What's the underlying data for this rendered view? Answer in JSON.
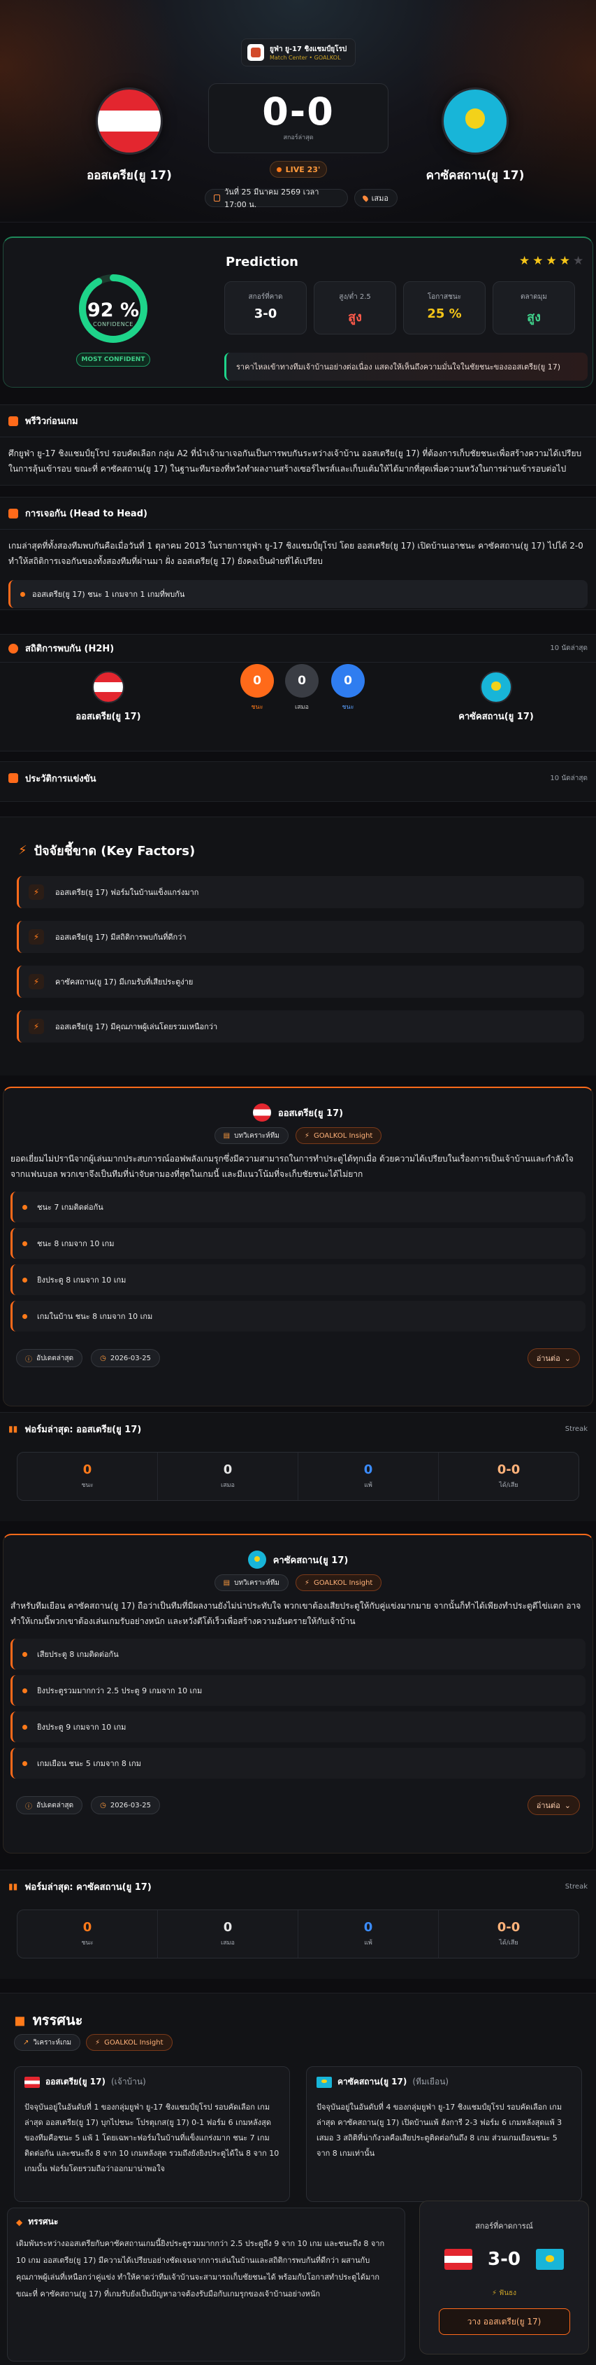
{
  "match": {
    "league_name": "ยูฟ่า ยู-17 ชิงแชมป์ยุโรป",
    "league_sub": "Match Center • GOALKOL",
    "home": "ออสเตรีย(ยู 17)",
    "away": "คาซัคสถาน(ยู 17)",
    "score": "0-0",
    "score_label": "สกอร์ล่าสุด",
    "status": "LIVE 23'",
    "date": "วันที่ 25 มีนาคม 2569 เวลา 17:00 น.",
    "venue": "เสมอ"
  },
  "prediction": {
    "title": "Prediction",
    "confidence": "92 %",
    "confidence_label": "CONFIDENCE",
    "confidence_value": 0.92,
    "confidence_badge": "MOST CONFIDENT",
    "stars": 4,
    "cards": [
      {
        "title": "สกอร์ที่คาด",
        "value": "3-0",
        "color": "#ffffff"
      },
      {
        "title": "สูง/ต่ำ 2.5",
        "value": "สูง",
        "color": "#ff5a4a"
      },
      {
        "title": "โอกาสชนะ",
        "value": "25 %",
        "color": "#f5c518"
      },
      {
        "title": "ตลาดมุม",
        "value": "สูง",
        "color": "#3fd08a"
      }
    ],
    "advice": "ราคาไหลเข้าทางทีมเจ้าบ้านอย่างต่อเนื่อง แสดงให้เห็นถึงความมั่นใจในชัยชนะของออสเตรีย(ยู 17)"
  },
  "preview": {
    "title": "พรีวิวก่อนเกม",
    "text": "ศึกยูฟ่า ยู-17 ชิงแชมป์ยุโรป รอบคัดเลือก กลุ่ม A2 ที่นำเจ้ามาเจอกันเป็นการพบกันระหว่างเจ้าบ้าน ออสเตรีย(ยู 17) ที่ต้องการเก็บชัยชนะเพื่อสร้างความได้เปรียบในการลุ้นเข้ารอบ ขณะที่ คาซัคสถาน(ยู 17) ในฐานะทีมรองที่หวังทำผลงานสร้างเซอร์ไพรส์และเก็บแต้มให้ได้มากที่สุดเพื่อความหวังในการผ่านเข้ารอบต่อไป"
  },
  "h2h_text": {
    "title": "การเจอกัน (Head to Head)",
    "text": "เกมล่าสุดที่ทั้งสองทีมพบกันคือเมื่อวันที่ 1 ตุลาคม 2013 ในรายการยูฟ่า ยู-17 ชิงแชมป์ยุโรป โดย ออสเตรีย(ยู 17) เปิดบ้านเอาชนะ คาซัคสถาน(ยู 17) ไปได้ 2-0 ทำให้สถิติการเจอกันของทั้งสองทีมที่ผ่านมา ฝั่ง ออสเตรีย(ยู 17) ยังคงเป็นฝ่ายที่ได้เปรียบ",
    "highlight": "ออสเตรีย(ยู 17) ชนะ 1 เกมจาก 1 เกมที่พบกัน"
  },
  "h2h_stats": {
    "title": "สถิติการพบกัน (H2H)",
    "right": "10 นัดล่าสุด",
    "home": "ออสเตรีย(ยู 17)",
    "away": "คาซัคสถาน(ยู 17)",
    "wins": "0",
    "wins_label": "ชนะ",
    "draws": "0",
    "draws_label": "เสมอ",
    "losses": "0",
    "losses_label": "ชนะ"
  },
  "history": {
    "title": "ประวัติการแข่งขัน",
    "right": "10 นัดล่าสุด"
  },
  "factors": {
    "title": "ปัจจัยชี้ขาด (Key Factors)",
    "items": [
      "ออสเตรีย(ยู 17) ฟอร์มในบ้านแข็งแกร่งมาก",
      "ออสเตรีย(ยู 17) มีสถิติการพบกันที่ดีกว่า",
      "คาซัคสถาน(ยู 17) มีเกมรับที่เสียประตูง่าย",
      "ออสเตรีย(ยู 17) มีคุณภาพผู้เล่นโดยรวมเหนือกว่า"
    ]
  },
  "home_card": {
    "team": "ออสเตรีย(ยู 17)",
    "badge1": "บทวิเคราะห์ทีม",
    "badge2": "GOALKOL Insight",
    "text": "ยอดเยี่ยมไม่ปรานีจากผู้เล่นมากประสบการณ์ออฟพลังเกมรุกซึ่งมีความสามารถในการทำประตูได้ทุกเมื่อ ด้วยความได้เปรียบในเรื่องการเป็นเจ้าบ้านและกำลังใจจากแฟนบอล พวกเขาจึงเป็นทีมที่น่าจับตามองที่สุดในเกมนี้ และมีแนวโน้มที่จะเก็บชัยชนะได้ไม่ยาก",
    "lines": [
      "ชนะ 7 เกมติดต่อกัน",
      "ชนะ 8 เกมจาก 10 เกม",
      "ยิงประตู 8 เกมจาก 10 เกม",
      "เกมในบ้าน ชนะ 8 เกมจาก 10 เกม"
    ],
    "foot1": "อัปเดตล่าสุด",
    "foot2": "2026-03-25",
    "readmore": "อ่านต่อ"
  },
  "home_form": {
    "title": "ฟอร์มล่าสุด: ออสเตรีย(ยู 17)",
    "right": "Streak",
    "cells": [
      {
        "n": "0",
        "l": "ชนะ",
        "c": "#ff7a1a"
      },
      {
        "n": "0",
        "l": "เสมอ",
        "c": "#e6e6e6"
      },
      {
        "n": "0",
        "l": "แพ้",
        "c": "#3b8cff"
      },
      {
        "n": "0-0",
        "l": "ได้/เสีย",
        "c": "#ffb27a"
      }
    ]
  },
  "away_card": {
    "team": "คาซัคสถาน(ยู 17)",
    "badge1": "บทวิเคราะห์ทีม",
    "badge2": "GOALKOL Insight",
    "text": "สำหรับทีมเยือน คาซัคสถาน(ยู 17) ถือว่าเป็นทีมที่มีผลงานยังไม่น่าประทับใจ พวกเขาต้องเสียประตูให้กับคู่แข่งมากมาย จากนั้นก็ทำได้เพียงทำประตูตีไข่แตก อาจทำให้เกมนี้พวกเขาต้องเล่นเกมรับอย่างหนัก และหวังตีโต้เร็วเพื่อสร้างความอันตรายให้กับเจ้าบ้าน",
    "lines": [
      "เสียประตู 8 เกมติดต่อกัน",
      "ยิงประตูรวมมากกว่า 2.5 ประตู 9 เกมจาก 10 เกม",
      "ยิงประตู 9 เกมจาก 10 เกม",
      "เกมเยือน ชนะ 5 เกมจาก 8 เกม"
    ],
    "foot1": "อัปเดตล่าสุด",
    "foot2": "2026-03-25",
    "readmore": "อ่านต่อ"
  },
  "away_form": {
    "title": "ฟอร์มล่าสุด: คาซัคสถาน(ยู 17)",
    "right": "Streak",
    "cells": [
      {
        "n": "0",
        "l": "ชนะ",
        "c": "#ff7a1a"
      },
      {
        "n": "0",
        "l": "เสมอ",
        "c": "#e6e6e6"
      },
      {
        "n": "0",
        "l": "แพ้",
        "c": "#3b8cff"
      },
      {
        "n": "0-0",
        "l": "ได้/เสีย",
        "c": "#ffb27a"
      }
    ]
  },
  "analysis": {
    "title": "ทรรศนะ",
    "badge1": "วิเคราะห์เกม",
    "badge2": "GOALKOL Insight",
    "home_head": "ออสเตรีย(ยู 17)",
    "home_sub": "(เจ้าบ้าน)",
    "home_text": "ปัจจุบันอยู่ในอันดับที่ 1 ของกลุ่มยูฟ่า ยู-17 ชิงแชมป์ยุโรป รอบคัดเลือก เกมล่าสุด ออสเตรีย(ยู 17) บุกไปชนะ โปรตุเกส(ยู 17) 0-1 ฟอร์ม 6 เกมหลังสุดของทีมคือชนะ 5 แพ้ 1 โดยเฉพาะฟอร์มในบ้านที่แข็งแกร่งมาก ชนะ 7 เกมติดต่อกัน และชนะถึง 8 จาก 10 เกมหลังสุด รวมถึงยังยิงประตูได้ใน 8 จาก 10 เกมนั้น ฟอร์มโดยรวมถือว่าออกมาน่าพอใจ",
    "away_head": "คาซัคสถาน(ยู 17)",
    "away_sub": "(ทีมเยือน)",
    "away_text": "ปัจจุบันอยู่ในอันดับที่ 4 ของกลุ่มยูฟ่า ยู-17 ชิงแชมป์ยุโรป รอบคัดเลือก เกมล่าสุด คาซัคสถาน(ยู 17) เปิดบ้านแพ้ ฮังการี 2-3 ฟอร์ม 6 เกมหลังสุดแพ้ 3 เสมอ 3 สถิติที่น่ากังวลคือเสียประตูติดต่อกันถึง 8 เกม ส่วนเกมเยือนชนะ 5 จาก 8 เกมเท่านั้น",
    "verdict_title": "ทรรศนะ",
    "verdict_text": "เดิมพันระหว่างออสเตรียกับคาซัคสถานเกมนี้ยิงประตูรวมมากกว่า 2.5 ประตูถึง 9 จาก 10 เกม และชนะถึง 8 จาก 10 เกม ออสเตรีย(ยู 17) มีความได้เปรียบอย่างชัดเจนจากการเล่นในบ้านและสถิติการพบกันที่ดีกว่า ผสานกับคุณภาพผู้เล่นที่เหนือกว่าคู่แข่ง ทำให้คาดว่าทีมเจ้าบ้านจะสามารถเก็บชัยชนะได้ พร้อมกับโอกาสทำประตูได้มาก ขณะที่ คาซัคสถาน(ยู 17) ที่เกมรับยังเป็นปัญหาอาจต้องรับมือกับเกมรุกของเจ้าบ้านอย่างหนัก",
    "pred_head": "สกอร์ที่คาดการณ์",
    "pred_score": "3-0",
    "pred_hint": "ฟันธง",
    "pred_button": "วาง ออสเตรีย(ยู 17)"
  },
  "colors": {
    "accent": "#ff6a1a",
    "green": "#1ed48a"
  }
}
